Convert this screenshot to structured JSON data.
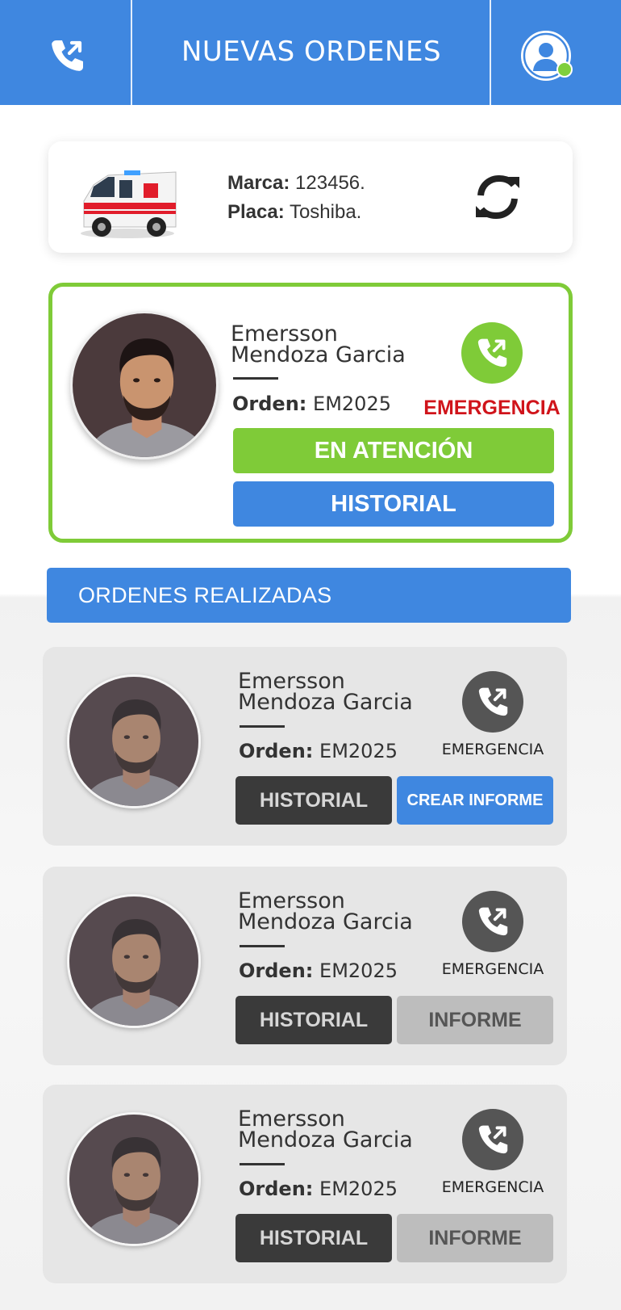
{
  "header": {
    "title": "NUEVAS ORDENES",
    "phone_icon": "phone-outgoing-icon",
    "profile_icon": "user-avatar-icon",
    "online_status_color": "#7fcf3c",
    "bg_color": "#3f87e0"
  },
  "vehicle": {
    "image": "ambulance-image",
    "marca_label": "Marca:",
    "marca_value": "123456.",
    "placa_label": "Placa:",
    "placa_value": "Toshiba.",
    "refresh_icon": "refresh-icon"
  },
  "active_order": {
    "name_first": "Emersson",
    "name_last": "Mendoza Garcia",
    "orden_label": "Orden:",
    "orden_value": "EM2025",
    "type_label": "EMERGENCIA",
    "status_button": "EN ATENCIÓN",
    "historial_button": "HISTORIAL",
    "accent_color": "#7fcb38",
    "emergency_color": "#d0141b"
  },
  "section_title": "ORDENES REALIZADAS",
  "completed_orders": [
    {
      "name_first": "Emersson",
      "name_last": "Mendoza Garcia",
      "orden_label": "Orden:",
      "orden_value": "EM2025",
      "type_label": "EMERGENCIA",
      "historial_button": "HISTORIAL",
      "report_button": "CREAR INFORME",
      "report_enabled": true
    },
    {
      "name_first": "Emersson",
      "name_last": "Mendoza Garcia",
      "orden_label": "Orden:",
      "orden_value": "EM2025",
      "type_label": "EMERGENCIA",
      "historial_button": "HISTORIAL",
      "report_button": "INFORME",
      "report_enabled": false
    },
    {
      "name_first": "Emersson",
      "name_last": "Mendoza Garcia",
      "orden_label": "Orden:",
      "orden_value": "EM2025",
      "type_label": "EMERGENCIA",
      "historial_button": "HISTORIAL",
      "report_button": "INFORME",
      "report_enabled": false
    }
  ]
}
